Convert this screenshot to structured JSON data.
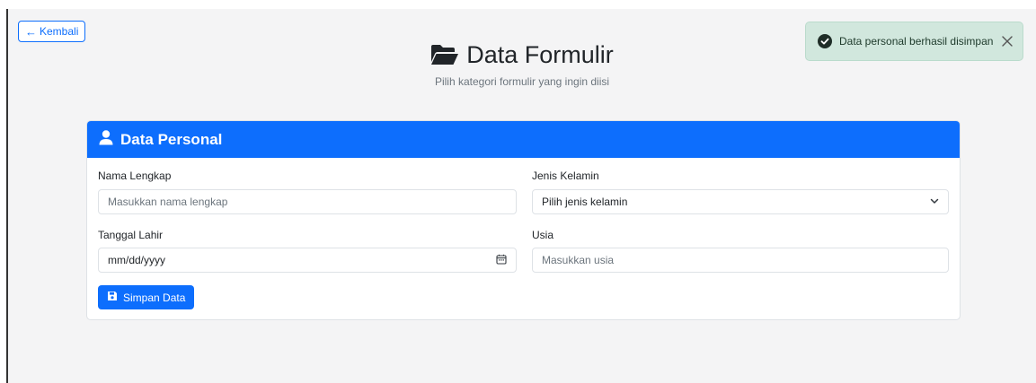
{
  "nav": {
    "back_label": "Kembali",
    "back_icon": "arrow-left-icon"
  },
  "header": {
    "title": "Data Formulir",
    "title_icon": "folder-open-icon",
    "subtitle": "Pilih kategori formulir yang ingin diisi"
  },
  "toast": {
    "message": "Data personal berhasil disimpan",
    "icon": "check-circle-icon",
    "close_icon": "close-icon",
    "type": "success"
  },
  "card": {
    "title": "Data Personal",
    "title_icon": "user-icon",
    "fields": {
      "nama": {
        "label": "Nama Lengkap",
        "placeholder": "Masukkan nama lengkap",
        "value": ""
      },
      "jenis_kelamin": {
        "label": "Jenis Kelamin",
        "selected": "Pilih jenis kelamin"
      },
      "tanggal_lahir": {
        "label": "Tanggal Lahir",
        "value": "mm/dd/yyyy"
      },
      "usia": {
        "label": "Usia",
        "placeholder": "Masukkan usia",
        "value": ""
      }
    },
    "submit_label": "Simpan Data",
    "submit_icon": "save-icon"
  },
  "colors": {
    "primary": "#0d6efd",
    "success_bg": "#d1e7dd",
    "success_icon": "#198754",
    "page_bg": "#f4f4f5"
  }
}
